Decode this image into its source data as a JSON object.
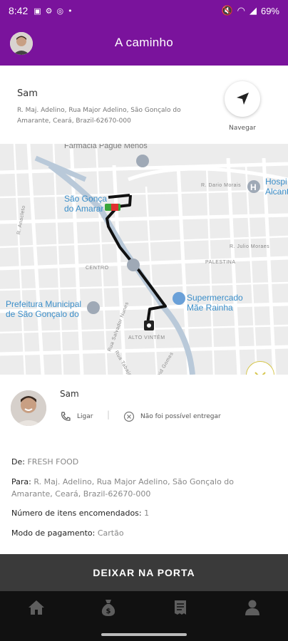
{
  "status_bar": {
    "time": "8:42",
    "battery": "69%"
  },
  "header": {
    "title": "A caminho"
  },
  "recipient": {
    "name": "Sam",
    "address": "R. Maj. Adelino, Rua Major Adelino, São Gonçalo do Amarante, Ceará, Brazil-62670-000",
    "navigate_label": "Navegar"
  },
  "map": {
    "labels": {
      "pharmacy": "Farmácia Pague Menos",
      "city_line1": "São Gonça",
      "city_line2": "do Amarar",
      "hospital_line1": "Hospi",
      "hospital_line2": "Alcant",
      "centro": "CENTRO",
      "palestina": "PALESTINA",
      "alto_vintem": "ALTO VINTÉM",
      "prefeitura_line1": "Prefeitura Municipal",
      "prefeitura_line2": "de São Gonçalo do",
      "supermercado_line1": "Supermercado",
      "supermercado_line2": "Mãe Rainha",
      "street_dario": "R. Dario Morais",
      "street_julio": "R. Julio Moraes",
      "street_anacleto": "R. Anacleto",
      "street_salvador": "Rua Salvador Nunes",
      "street_tabajara": "Rua Tabajara",
      "street_gomes": "Zeid Gomes"
    }
  },
  "courier": {
    "name": "Sam",
    "call_label": "Ligar",
    "fail_label": "Não foi possível entregar"
  },
  "order": {
    "from_label": "De:",
    "from_value": "FRESH FOOD",
    "to_label": "Para:",
    "to_value": "R. Maj. Adelino, Rua Major Adelino, São Gonçalo do Amarante, Ceará, Brazil-62670-000",
    "items_label": "Número de itens encomendados:",
    "items_value": "1",
    "payment_label": "Modo de pagamento:",
    "payment_value": "Cartão"
  },
  "actions": {
    "leave_at_door": "DEIXAR NA PORTA"
  },
  "bottom_nav": [
    "home-icon",
    "money-bag-icon",
    "receipt-icon",
    "profile-icon"
  ],
  "colors": {
    "brand_purple": "#7a139c",
    "action_dark": "#3a3a3a",
    "accent_yellow": "#d6c64d"
  }
}
